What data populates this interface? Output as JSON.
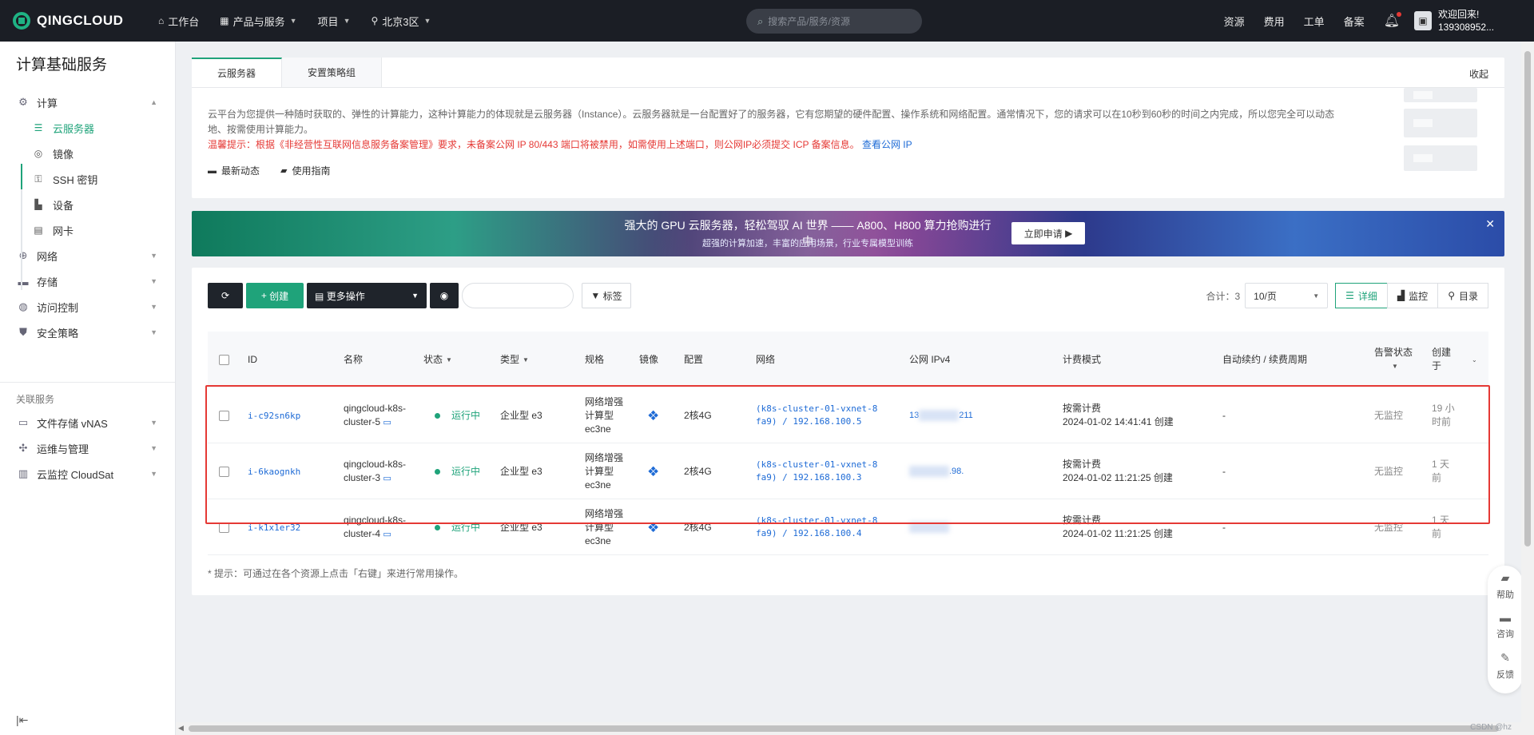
{
  "topbar": {
    "brand": "QINGCLOUD",
    "nav": [
      {
        "icon": "home-icon",
        "glyph": "⌂",
        "label": "工作台",
        "caret": false
      },
      {
        "icon": "grid-icon",
        "glyph": "▦",
        "label": "产品与服务",
        "caret": true
      },
      {
        "icon": "",
        "glyph": "",
        "label": "项目",
        "caret": true
      },
      {
        "icon": "location-icon",
        "glyph": "⚲",
        "label": "北京3区",
        "caret": true
      }
    ],
    "search_placeholder": "搜索产品/服务/资源",
    "links": [
      "资源",
      "费用",
      "工单",
      "备案"
    ],
    "user": {
      "greeting": "欢迎回来!",
      "account": "139308952..."
    }
  },
  "sidebar": {
    "title": "计算基础服务",
    "compute": {
      "label": "计算",
      "items": [
        "云服务器",
        "镜像",
        "SSH 密钥",
        "设备",
        "网卡"
      ]
    },
    "groups": [
      "网络",
      "存储",
      "访问控制",
      "安全策略"
    ],
    "related_title": "关联服务",
    "related": [
      "文件存储 vNAS",
      "运维与管理",
      "云监控 CloudSat"
    ]
  },
  "tabs": [
    "云服务器",
    "安置策略组"
  ],
  "collapse_label": "收起",
  "intro": {
    "text": "云平台为您提供一种随时获取的、弹性的计算能力，这种计算能力的体现就是云服务器（Instance）。云服务器就是一台配置好了的服务器，它有您期望的硬件配置、操作系统和网络配置。通常情况下，您的请求可以在10秒到60秒的时间之内完成，所以您完全可以动态地、按需使用计算能力。",
    "warning": "温馨提示：根据《非经营性互联网信息服务备案管理》要求，未备案公网 IP 80/443 端口将被禁用，如需使用上述端口，则公网IP必须提交 ICP 备案信息。",
    "warning_link": "查看公网 IP",
    "link_news": "最新动态",
    "link_guide": "使用指南"
  },
  "banner": {
    "title": "强大的 GPU 云服务器，轻松驾驭 AI 世界 —— A800、H800 算力抢购进行中",
    "subtitle": "超强的计算加速，丰富的应用场景，行业专属模型训练",
    "cta": "立即申请"
  },
  "toolbar": {
    "create": "创建",
    "more": "更多操作",
    "tags": "标签",
    "total": "合计：3",
    "page_size": "10/页",
    "views": [
      "详细",
      "监控",
      "目录"
    ]
  },
  "table": {
    "headers": {
      "id": "ID",
      "name": "名称",
      "status": "状态",
      "type": "类型",
      "spec": "规格",
      "image": "镜像",
      "config": "配置",
      "network": "网络",
      "ip": "公网 IPv4",
      "billing": "计费模式",
      "renew": "自动续约 / 续费周期",
      "alarm": "告警状态",
      "created": "创建于"
    },
    "rows": [
      {
        "id": "i-c92sn6kp",
        "name1": "qingcloud-k8s-",
        "name2": "cluster-5",
        "status": "运行中",
        "type": "企业型 e3",
        "spec1": "网络增强",
        "spec2": "计算型",
        "spec3": "ec3ne",
        "config": "2核4G",
        "net1": "(k8s-cluster-01-vxnet-8",
        "net2": "fa9) / 192.168.100.5",
        "ip_left": "13",
        "ip_right": "211",
        "billing": "按需计费",
        "billing_time": "2024-01-02 14:41:41 创建",
        "renew": "-",
        "alarm": "无监控",
        "created1": "19 小",
        "created2": "时前"
      },
      {
        "id": "i-6kaognkh",
        "name1": "qingcloud-k8s-",
        "name2": "cluster-3",
        "status": "运行中",
        "type": "企业型 e3",
        "spec1": "网络增强",
        "spec2": "计算型",
        "spec3": "ec3ne",
        "config": "2核4G",
        "net1": "(k8s-cluster-01-vxnet-8",
        "net2": "fa9) / 192.168.100.3",
        "ip_left": "",
        "ip_right": ".98.",
        "billing": "按需计费",
        "billing_time": "2024-01-02 11:21:25 创建",
        "renew": "-",
        "alarm": "无监控",
        "created1": "1 天",
        "created2": "前"
      },
      {
        "id": "i-k1x1er32",
        "name1": "qingcloud-k8s-",
        "name2": "cluster-4",
        "status": "运行中",
        "type": "企业型 e3",
        "spec1": "网络增强",
        "spec2": "计算型",
        "spec3": "ec3ne",
        "config": "2核4G",
        "net1": "(k8s-cluster-01-vxnet-8",
        "net2": "fa9) / 192.168.100.4",
        "ip_left": "",
        "ip_right": "",
        "billing": "按需计费",
        "billing_time": "2024-01-02 11:21:25 创建",
        "renew": "-",
        "alarm": "无监控",
        "created1": "1 天",
        "created2": "前"
      }
    ],
    "hint": "* 提示：可通过在各个资源上点击「右键」来进行常用操作。"
  },
  "float": [
    "帮助",
    "咨询",
    "反馈"
  ],
  "watermark": "CSDN @hz"
}
